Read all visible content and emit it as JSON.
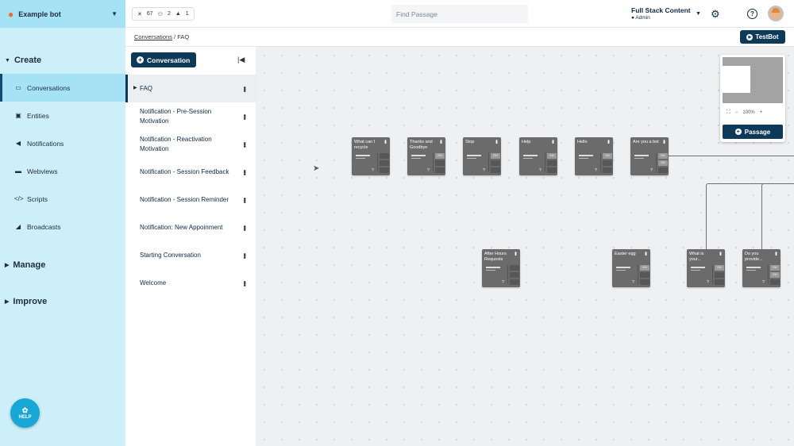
{
  "bot": {
    "name": "Example bot"
  },
  "nav": {
    "create_label": "Create",
    "items": [
      {
        "label": "Conversations",
        "icon": "chat-icon"
      },
      {
        "label": "Entities",
        "icon": "entity-icon"
      },
      {
        "label": "Notifications",
        "icon": "megaphone-icon"
      },
      {
        "label": "Webviews",
        "icon": "webview-icon"
      },
      {
        "label": "Scripts",
        "icon": "code-icon"
      },
      {
        "label": "Broadcasts",
        "icon": "broadcast-icon"
      }
    ],
    "manage_label": "Manage",
    "improve_label": "Improve",
    "help_label": "HELP"
  },
  "topbar": {
    "stats": {
      "tools": "67",
      "bots": "2",
      "locks": "1"
    },
    "search_placeholder": "Find Passage",
    "account_name": "Full Stack Content",
    "account_role": "Admin"
  },
  "breadcrumb": {
    "root": "Conversations",
    "sep": "/",
    "current": "FAQ"
  },
  "testbot_label": "TestBot",
  "conv_panel": {
    "new_button": "Conversation",
    "items": [
      "FAQ",
      "Notification - Pre-Session Motivation",
      "Notification - Reactivation Motivation",
      "Notification - Session Feedback",
      "Notification - Session Reminder",
      "Notification: New Appoinment",
      "Starting Conversation",
      "Welcome"
    ]
  },
  "canvas": {
    "nodes": [
      {
        "title": "What can I recycle",
        "tags": []
      },
      {
        "title": "Thanks and Goodbye",
        "tags": [
          "SW"
        ]
      },
      {
        "title": "Stop",
        "tags": [
          "SW"
        ]
      },
      {
        "title": "Help",
        "tags": [
          "SW"
        ]
      },
      {
        "title": "Hello",
        "tags": [
          "SW"
        ]
      },
      {
        "title": "Are you a bot",
        "tags": [
          "SW",
          "SW"
        ]
      },
      {
        "title": "After Hours Requests",
        "tags": []
      },
      {
        "title": "Easter egg",
        "tags": [
          "SW"
        ]
      },
      {
        "title": "What is your...",
        "tags": [
          "SW"
        ]
      },
      {
        "title": "Do you provide...",
        "tags": [
          "SW",
          "SW"
        ]
      }
    ],
    "minimap": {
      "zoom": "100%",
      "add_label": "Passage"
    }
  }
}
